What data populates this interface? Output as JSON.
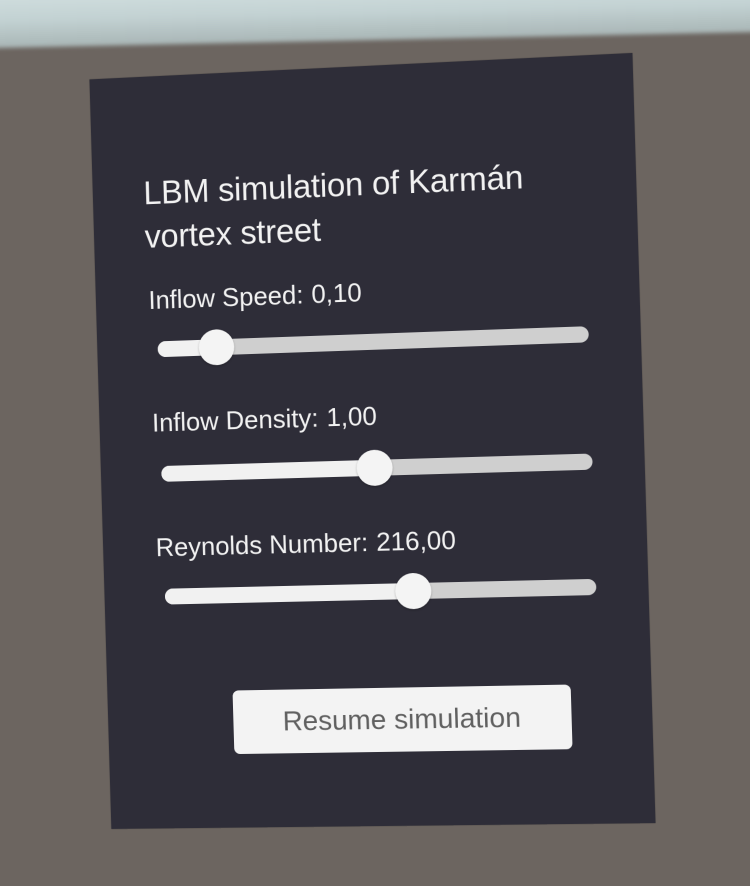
{
  "panel": {
    "title": "LBM simulation of Karmán vortex street",
    "sliders": [
      {
        "label": "Inflow Speed:",
        "value_text": "0,10",
        "fraction": 0.14
      },
      {
        "label": "Inflow Density:",
        "value_text": "1,00",
        "fraction": 0.5
      },
      {
        "label": "Reynolds Number:",
        "value_text": "216,00",
        "fraction": 0.58
      }
    ],
    "resume_label": "Resume simulation"
  },
  "colors": {
    "background": "#6c6560",
    "panel": "#2e2d38",
    "text": "#f2f2f2",
    "slider_track": "#cfcfcf",
    "slider_fill": "#f1f1f1"
  }
}
